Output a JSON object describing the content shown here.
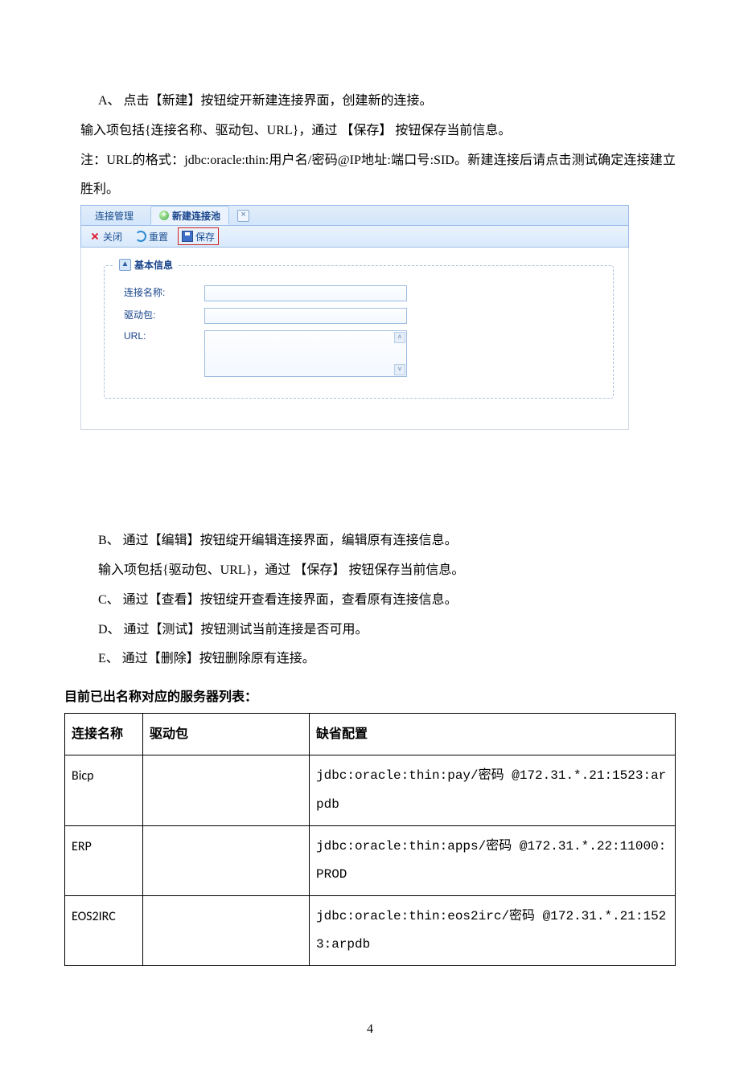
{
  "text": {
    "p_a": "A、 点击【新建】按钮绽开新建连接界面，创建新的连接。",
    "p_a2": "输入项包括{连接名称、驱动包、URL}，通过 【保存】 按钮保存当前信息。",
    "p_a3": "注：URL的格式：jdbc:oracle:thin:用户名/密码@IP地址:端口号:SID。新建连接后请点击测试确定连接建立胜利。",
    "p_b": "B、 通过【编辑】按钮绽开编辑连接界面，编辑原有连接信息。",
    "p_b2": "输入项包括{驱动包、URL}，通过 【保存】 按钮保存当前信息。",
    "p_c": "C、 通过【查看】按钮绽开查看连接界面，查看原有连接信息。",
    "p_d": "D、 通过【测试】按钮测试当前连接是否可用。",
    "p_e": "E、 通过【删除】按钮删除原有连接。",
    "heading": "目前已出名称对应的服务器列表：",
    "page_number": "4"
  },
  "ui": {
    "tabs": {
      "tab1": "连接管理",
      "tab2": "新建连接池"
    },
    "toolbar": {
      "close": "关闭",
      "reset": "重置",
      "save": "保存"
    },
    "fieldset_title": "基本信息",
    "labels": {
      "name": "连接名称:",
      "driver": "驱动包:",
      "url": "URL:"
    },
    "legend_toggle": "▲",
    "ta_up": "˄",
    "ta_dn": "˅",
    "tab_close": "×"
  },
  "table": {
    "headers": {
      "name": "连接名称",
      "driver": "驱动包",
      "default": "缺省配置"
    },
    "rows": [
      {
        "name": "Bicp",
        "driver": "",
        "default": "jdbc:oracle:thin:pay/密码 @172.31.*.21:1523:arpdb"
      },
      {
        "name": "ERP",
        "driver": "",
        "default": "jdbc:oracle:thin:apps/密码 @172.31.*.22:11000:PROD"
      },
      {
        "name": "EOS2IRC",
        "driver": "",
        "default": "jdbc:oracle:thin:eos2irc/密码 @172.31.*.21:1523:arpdb"
      }
    ]
  }
}
